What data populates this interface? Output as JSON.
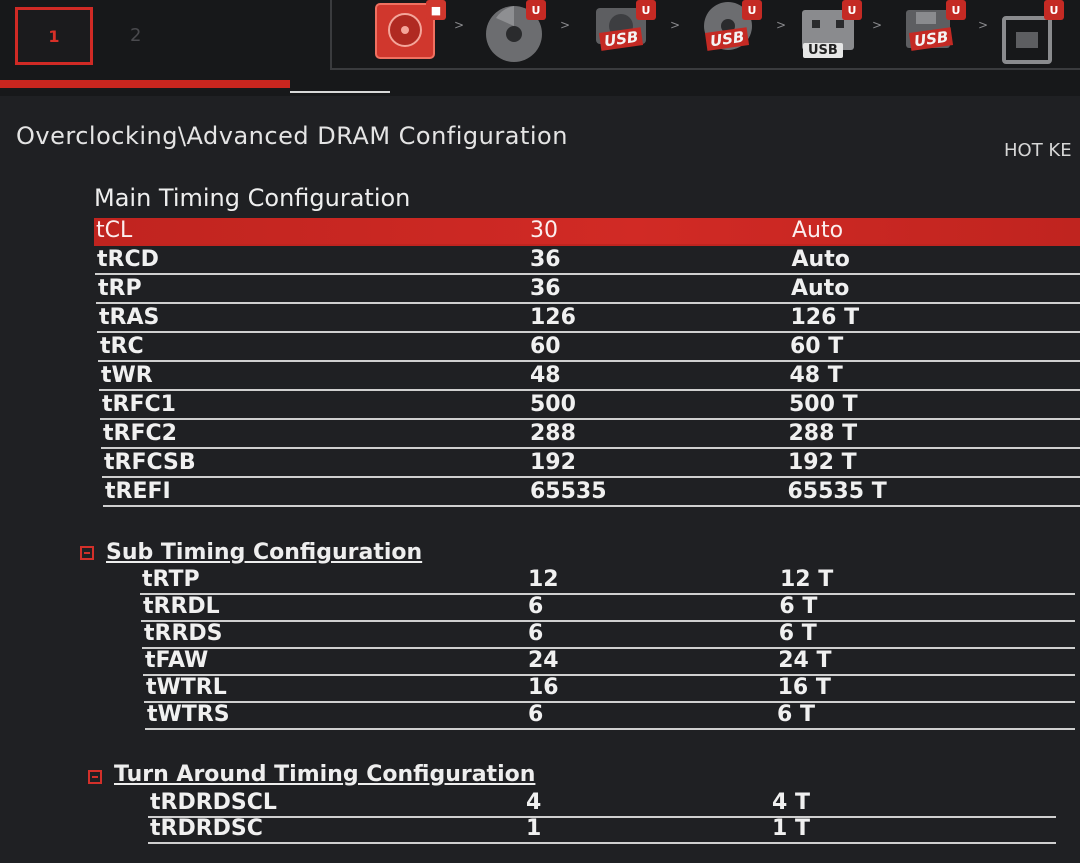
{
  "header": {
    "tab_active": "1",
    "tab_inactive": "2",
    "boot_devices": [
      {
        "icon": "hdd-icon",
        "badge": ""
      },
      {
        "icon": "optical-disc-icon",
        "badge": "U"
      },
      {
        "icon": "usb-hdd-icon",
        "badge": "U",
        "label": "USB"
      },
      {
        "icon": "usb-cd-icon",
        "badge": "U",
        "label": "USB"
      },
      {
        "icon": "usb-key-icon",
        "badge": "U",
        "label": "USB"
      },
      {
        "icon": "usb-floppy-icon",
        "badge": "U",
        "label": "USB"
      },
      {
        "icon": "network-icon",
        "badge": "U"
      }
    ],
    "arrow": ">",
    "accent_color": "#c8261f"
  },
  "breadcrumb": "Overclocking\\Advanced DRAM Configuration",
  "hotkey_label": "HOT KE",
  "collapse_icon": "−",
  "main_timing": {
    "title": "Main Timing Configuration",
    "rows": [
      {
        "name": "tCL",
        "value": "30",
        "setting": "Auto"
      },
      {
        "name": "tRCD",
        "value": "36",
        "setting": "Auto"
      },
      {
        "name": "tRP",
        "value": "36",
        "setting": "Auto"
      },
      {
        "name": "tRAS",
        "value": "126",
        "setting": "126 T"
      },
      {
        "name": "tRC",
        "value": "60",
        "setting": "60 T"
      },
      {
        "name": "tWR",
        "value": "48",
        "setting": "48 T"
      },
      {
        "name": "tRFC1",
        "value": "500",
        "setting": "500 T"
      },
      {
        "name": "tRFC2",
        "value": "288",
        "setting": "288 T"
      },
      {
        "name": "tRFCSB",
        "value": "192",
        "setting": "192 T"
      },
      {
        "name": "tREFI",
        "value": "65535",
        "setting": "65535 T"
      }
    ]
  },
  "sub_timing": {
    "title": "Sub Timing Configuration",
    "rows": [
      {
        "name": "tRTP",
        "value": "12",
        "setting": "12 T"
      },
      {
        "name": "tRRDL",
        "value": "6",
        "setting": "6 T"
      },
      {
        "name": "tRRDS",
        "value": "6",
        "setting": "6 T"
      },
      {
        "name": "tFAW",
        "value": "24",
        "setting": "24 T"
      },
      {
        "name": "tWTRL",
        "value": "16",
        "setting": "16 T"
      },
      {
        "name": "tWTRS",
        "value": "6",
        "setting": "6 T"
      }
    ]
  },
  "turn_around": {
    "title": "Turn Around Timing Configuration",
    "rows": [
      {
        "name": "tRDRDSCL",
        "value": "4",
        "setting": "4 T"
      },
      {
        "name": "tRDRDSC",
        "value": "1",
        "setting": "1 T"
      }
    ]
  }
}
